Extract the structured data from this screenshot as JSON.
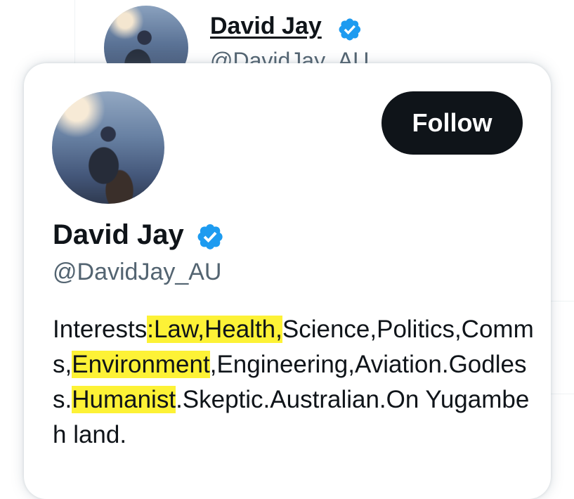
{
  "background_tweet": {
    "name": "David Jay",
    "handle": "@DavidJay_AU"
  },
  "hover_card": {
    "name": "David Jay",
    "handle": "@DavidJay_AU",
    "follow_label": "Follow",
    "verified_icon": "verified-badge-icon",
    "colors": {
      "verified": "#1d9bf0",
      "follow_bg": "#0f1419",
      "highlight": "#fdf236",
      "handle": "#536471"
    },
    "bio": {
      "s1": "Interests",
      "h1": ":Law,Health,",
      "s2": "Science,Politics,Comms,",
      "h2": "Environment",
      "s3": ",Engineering,Aviation.Godless.",
      "h3": "Humanist",
      "s4": ".Skeptic.Australian.On Yugambeh land."
    }
  }
}
